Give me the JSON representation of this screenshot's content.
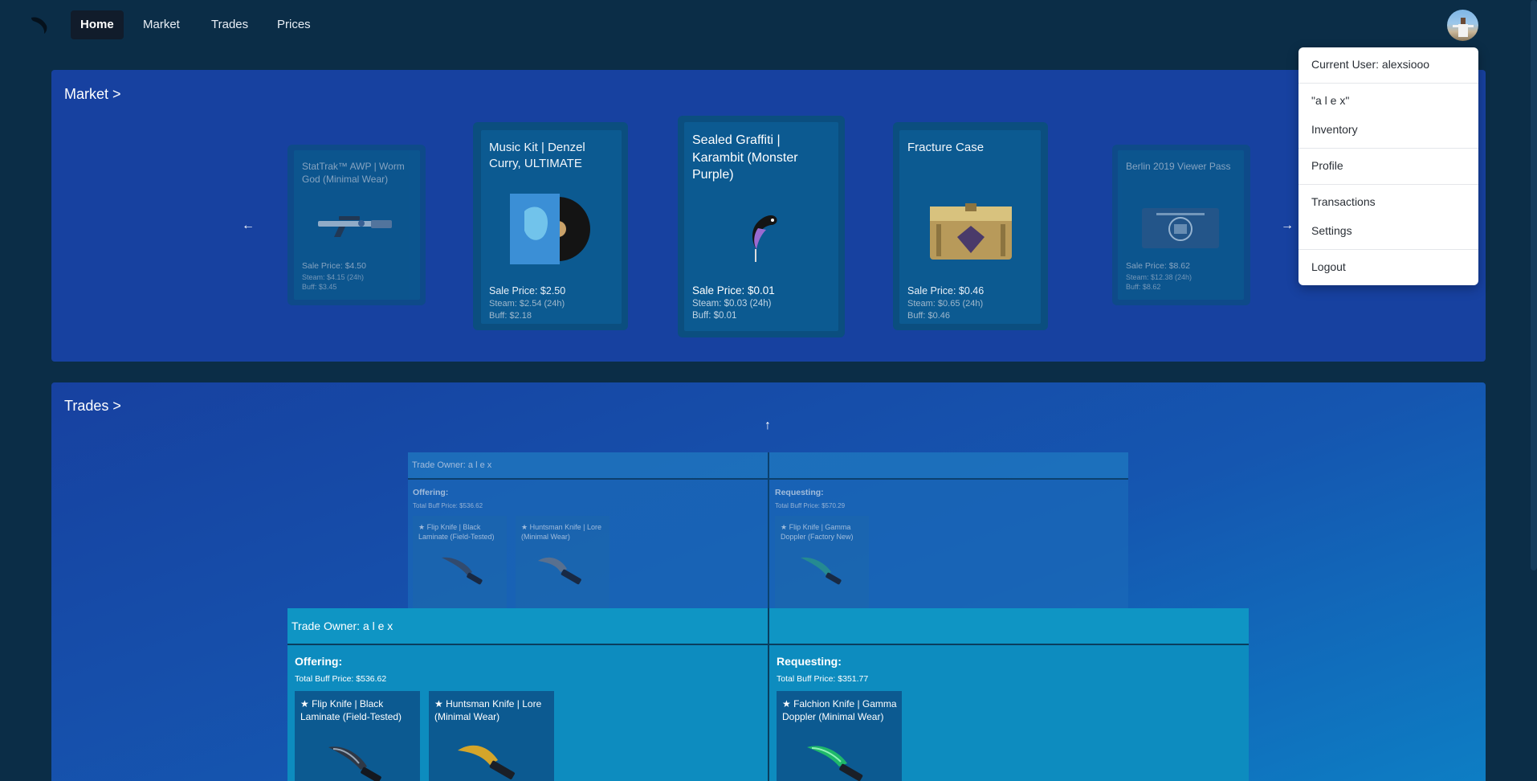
{
  "nav": {
    "items": [
      {
        "label": "Home",
        "active": true
      },
      {
        "label": "Market",
        "active": false
      },
      {
        "label": "Trades",
        "active": false
      },
      {
        "label": "Prices",
        "active": false
      }
    ]
  },
  "market": {
    "title": "Market >",
    "prev_arrow": "←",
    "next_arrow": "→",
    "cards": [
      {
        "name": "StatTrak™ AWP | Worm God (Minimal Wear)",
        "sale": "Sale Price: $4.50",
        "steam": "Steam: $4.15 (24h)",
        "buff": "Buff: $3.45"
      },
      {
        "name": "Music Kit | Denzel Curry, ULTIMATE",
        "sale": "Sale Price: $2.50",
        "steam": "Steam: $2.54 (24h)",
        "buff": "Buff: $2.18"
      },
      {
        "name": "Sealed Graffiti | Karambit (Monster Purple)",
        "sale": "Sale Price: $0.01",
        "steam": "Steam: $0.03 (24h)",
        "buff": "Buff: $0.01"
      },
      {
        "name": "Fracture Case",
        "sale": "Sale Price: $0.46",
        "steam": "Steam: $0.65 (24h)",
        "buff": "Buff: $0.46"
      },
      {
        "name": "Berlin 2019 Viewer Pass",
        "sale": "Sale Price: $8.62",
        "steam": "Steam: $12.38 (24h)",
        "buff": "Buff: $8.62"
      }
    ]
  },
  "trades": {
    "title": "Trades >",
    "up_arrow": "↑",
    "back_trade": {
      "owner": "Trade Owner: a l e x",
      "offering_label": "Offering:",
      "offering_total": "Total Buff Price: $536.62",
      "offering_items": [
        "★ Flip Knife | Black Laminate (Field-Tested)",
        "★ Huntsman Knife | Lore (Minimal Wear)"
      ],
      "requesting_label": "Requesting:",
      "requesting_total": "Total Buff Price: $570.29",
      "requesting_items": [
        "★ Flip Knife | Gamma Doppler (Factory New)"
      ]
    },
    "front_trade": {
      "owner": "Trade Owner: a l e x",
      "offering_label": "Offering:",
      "offering_total": "Total Buff Price: $536.62",
      "offering_items": [
        "★ Flip Knife | Black Laminate (Field-Tested)",
        "★ Huntsman Knife | Lore (Minimal Wear)"
      ],
      "requesting_label": "Requesting:",
      "requesting_total": "Total Buff Price: $351.77",
      "requesting_items": [
        "★ Falchion Knife | Gamma Doppler (Minimal Wear)"
      ]
    }
  },
  "user_menu": {
    "current_user": "Current User: alexsiooo",
    "display_name": "\"a l e x\"",
    "inventory": "Inventory",
    "profile": "Profile",
    "transactions": "Transactions",
    "settings": "Settings",
    "logout": "Logout"
  }
}
